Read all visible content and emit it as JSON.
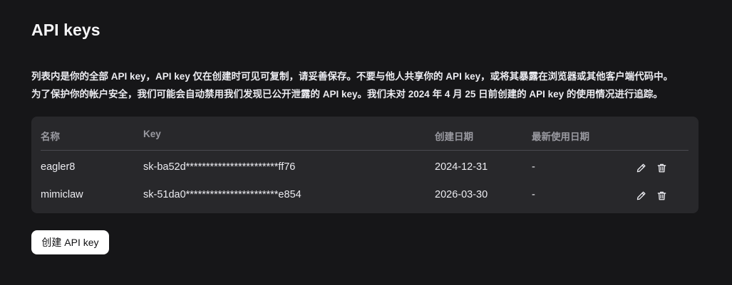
{
  "page": {
    "title": "API keys"
  },
  "description": {
    "line1": "列表内是你的全部 API key，API key 仅在创建时可见可复制，请妥善保存。不要与他人共享你的 API key，或将其暴露在浏览器或其他客户端代码中。",
    "line2": "为了保护你的帐户安全，我们可能会自动禁用我们发现已公开泄露的 API key。我们未对 2024 年 4 月 25 日前创建的 API key 的使用情况进行追踪。"
  },
  "table": {
    "headers": {
      "name": "名称",
      "key": "Key",
      "created": "创建日期",
      "last_used": "最新使用日期"
    },
    "rows": [
      {
        "name": "eagler8",
        "key": "sk-ba52d***********************ff76",
        "created": "2024-12-31",
        "last_used": "-"
      },
      {
        "name": "mimiclaw",
        "key": "sk-51da0***********************e854",
        "created": "2026-03-30",
        "last_used": "-"
      }
    ],
    "row_actions": [
      "pencil-icon",
      "trash-icon"
    ]
  },
  "actions": {
    "create_label": "创建 API key"
  },
  "colors": {
    "background": "#161618",
    "panel": "#28282b",
    "text": "#ececf1",
    "muted": "#9a9aa1",
    "button_bg": "#ffffff"
  }
}
